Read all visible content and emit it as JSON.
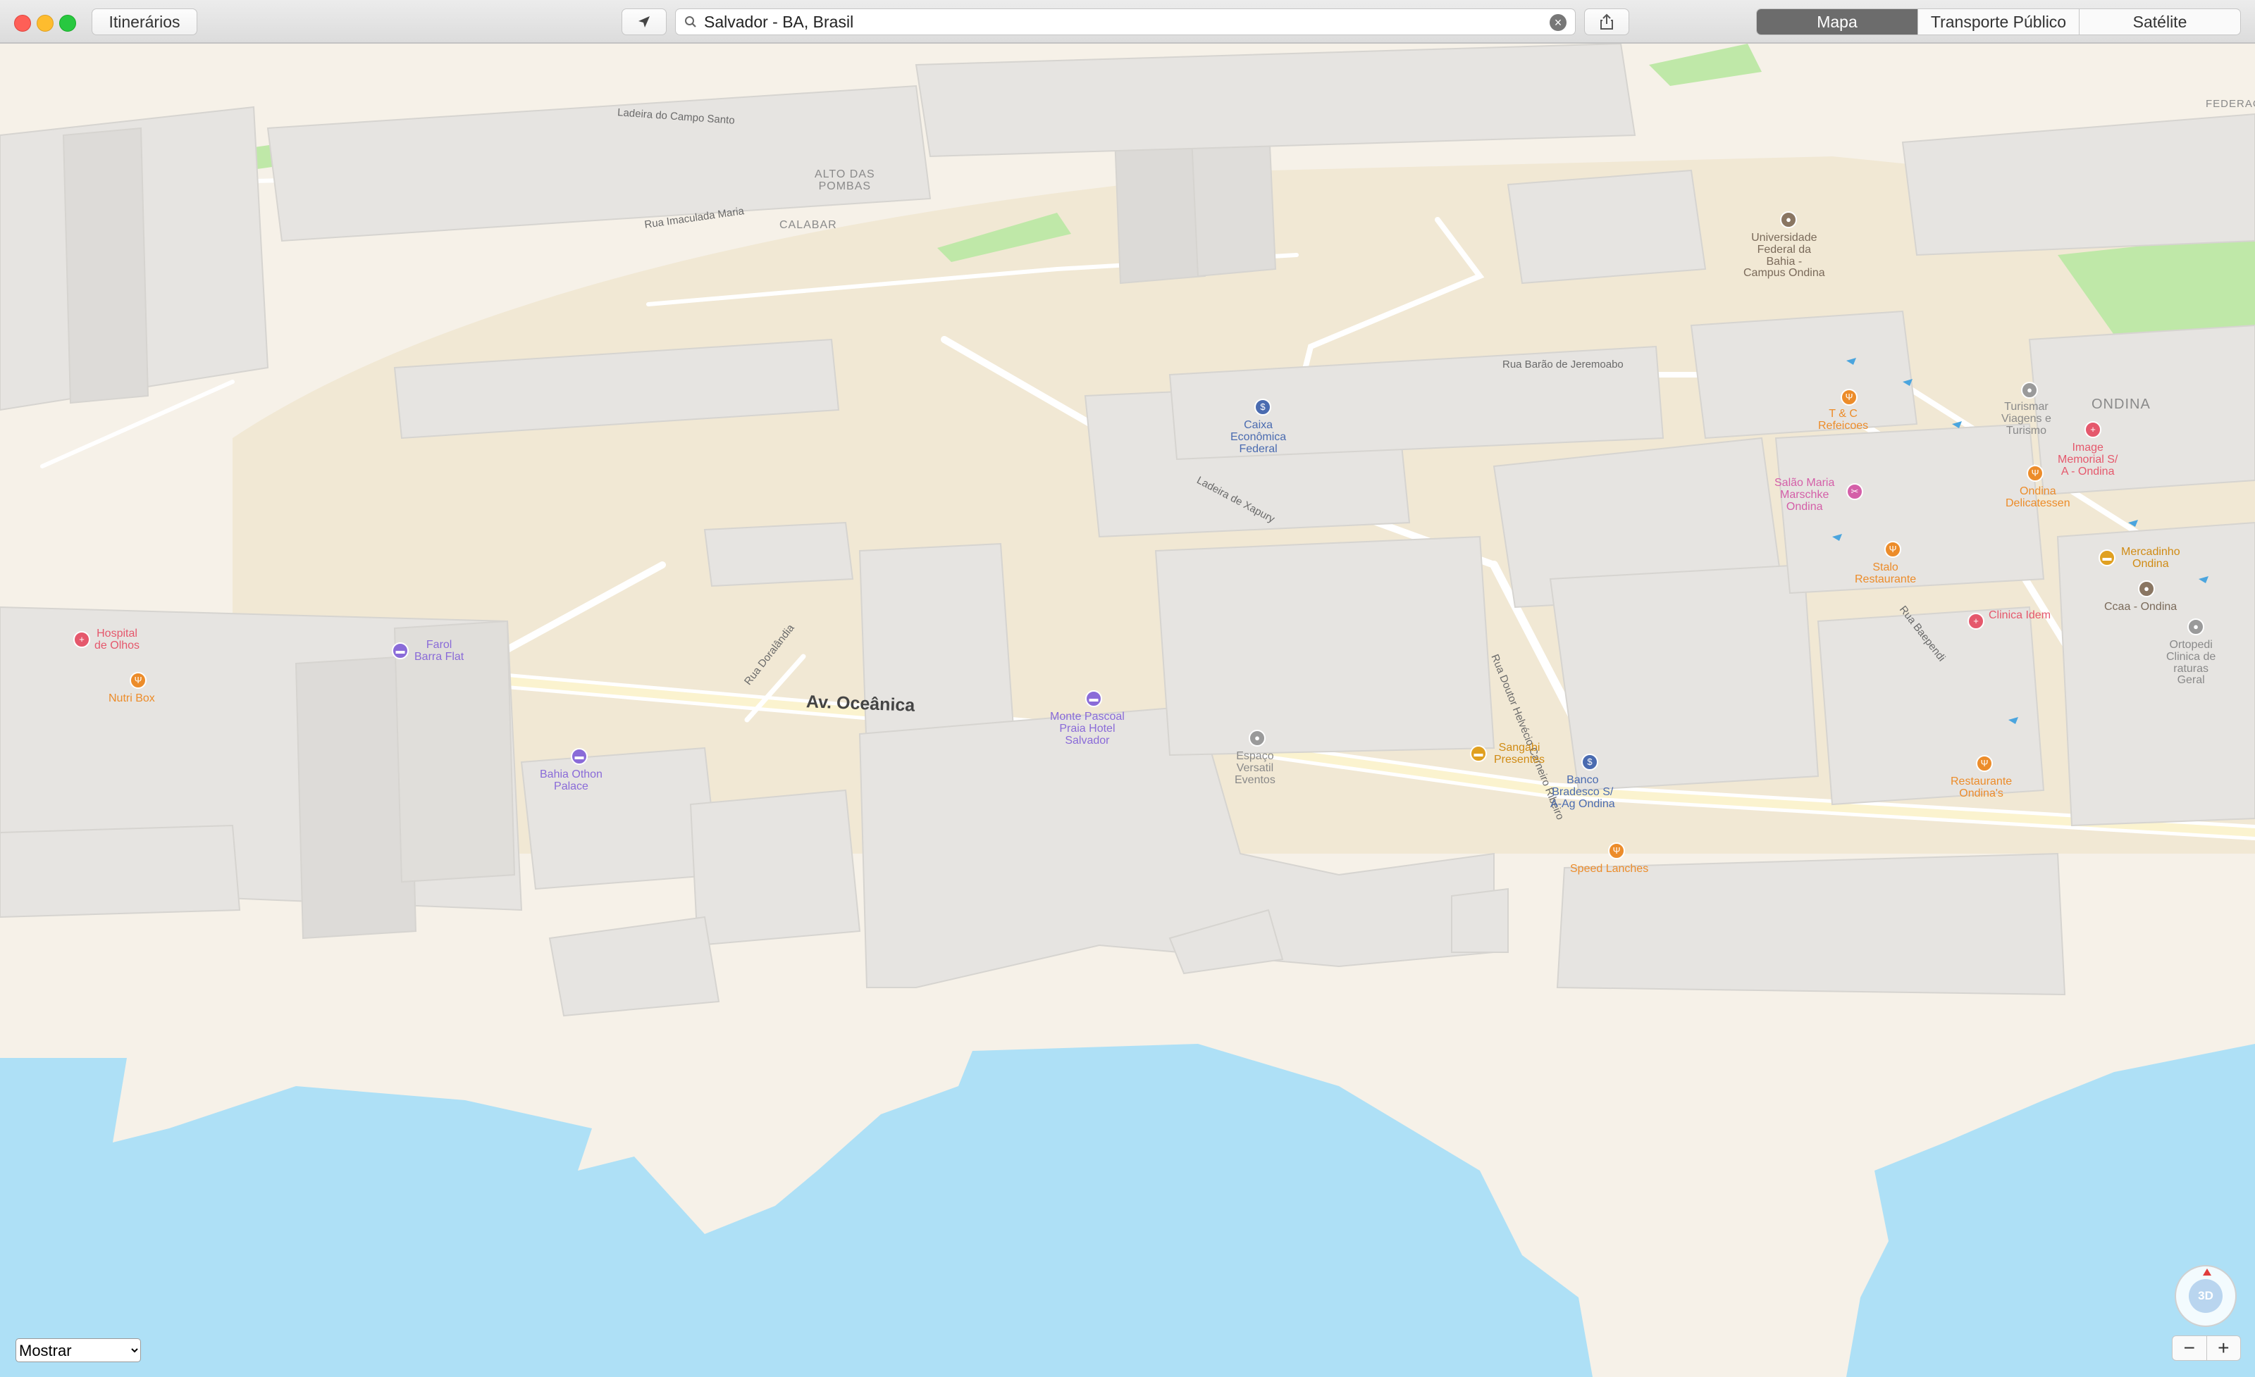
{
  "toolbar": {
    "directions_label": "Itinerários",
    "search_value": "Salvador - BA, Brasil",
    "map_modes": [
      {
        "label": "Mapa",
        "active": true
      },
      {
        "label": "Transporte Público",
        "active": false
      },
      {
        "label": "Satélite",
        "active": false
      }
    ]
  },
  "map": {
    "streets": {
      "campo_santo": "Ladeira do Campo Santo",
      "imaculada_maria": "Rua Imaculada Maria",
      "barao_jeremoabo": "Rua Barão de Jeremoabo",
      "xapuri": "Ladeira de Xapury",
      "doralandia": "Rua Doralândia",
      "helvecio": "Rua Doutor Helvécio Carneiro Ribeiro",
      "baependi": "Rua Baependi",
      "oceanica": "Av. Oceânica"
    },
    "areas": {
      "alto_das_pombas": "ALTO DAS\nPOMBAS",
      "calabar": "CALABAR",
      "ondina": "ONDINA",
      "federacao": "FEDERAC"
    },
    "pois": [
      {
        "id": "hospital-olhos",
        "label": "Hospital\nde Olhos",
        "color": "red",
        "glyph": "+"
      },
      {
        "id": "nutri-box",
        "label": "Nutri Box",
        "color": "orange",
        "glyph": "Ψ"
      },
      {
        "id": "farol-barra-flat",
        "label": "Farol\nBarra Flat",
        "color": "purple",
        "glyph": "▬"
      },
      {
        "id": "bahia-othon-palace",
        "label": "Bahia Othon\nPalace",
        "color": "purple",
        "glyph": "▬"
      },
      {
        "id": "monte-pascoal",
        "label": "Monte Pascoal\nPraia Hotel\nSalvador",
        "color": "purple",
        "glyph": "▬"
      },
      {
        "id": "espaco-versatil",
        "label": "Espaço\nVersatil\nEventos",
        "color": "gray",
        "glyph": "●"
      },
      {
        "id": "caixa",
        "label": "Caixa\nEconômica\nFederal",
        "color": "blue",
        "glyph": "$"
      },
      {
        "id": "sangabi",
        "label": "Sangabi\nPresentes",
        "color": "gold",
        "glyph": "▬"
      },
      {
        "id": "bradesco",
        "label": "Banco\nBradesco S/\nA-Ag Ondina",
        "color": "blue",
        "glyph": "$"
      },
      {
        "id": "speed-lanches",
        "label": "Speed Lanches",
        "color": "orange",
        "glyph": "Ψ"
      },
      {
        "id": "universidade",
        "label": "Universidade\nFederal da\nBahia -\nCampus Ondina",
        "color": "brown",
        "glyph": "●"
      },
      {
        "id": "tc-refeicoes",
        "label": "T & C\nRefeicoes",
        "color": "orange",
        "glyph": "Ψ"
      },
      {
        "id": "turismar",
        "label": "Turismar\nViagens e\nTurismo",
        "color": "gray",
        "glyph": "●"
      },
      {
        "id": "image-memorial",
        "label": "Image\nMemorial S/\nA - Ondina",
        "color": "red",
        "glyph": "+"
      },
      {
        "id": "salao-maria",
        "label": "Salão Maria\nMarschke\nOndina",
        "color": "pink",
        "glyph": "✂"
      },
      {
        "id": "ondina-delicatessen",
        "label": "Ondina\nDelicatessen",
        "color": "orange",
        "glyph": "Ψ"
      },
      {
        "id": "mercadinho",
        "label": "Mercadinho\nOndina",
        "color": "gold",
        "glyph": "▬"
      },
      {
        "id": "stalo",
        "label": "Stalo\nRestaurante",
        "color": "orange",
        "glyph": "Ψ"
      },
      {
        "id": "ccaa",
        "label": "Ccaa - Ondina",
        "color": "brown",
        "glyph": "●"
      },
      {
        "id": "clinica-idem",
        "label": "Clinica Idem",
        "color": "red",
        "glyph": "+"
      },
      {
        "id": "ortopedia",
        "label": "Ortopedi\nClinica de\nraturas\nGeral",
        "color": "gray",
        "glyph": "●"
      },
      {
        "id": "restaurante-ondina",
        "label": "Restaurante\nOndina's",
        "color": "orange",
        "glyph": "Ψ"
      }
    ]
  },
  "bottom": {
    "show_select": "Mostrar",
    "compass_label": "3D",
    "zoom_out": "−",
    "zoom_in": "+"
  },
  "icons": {
    "location": "location-arrow-icon",
    "search": "search-icon",
    "clear": "clear-icon",
    "share": "share-icon"
  },
  "colors": {
    "water": "#aee0f6",
    "land": "#f6f1e8",
    "urban": "#f1e8d4",
    "park": "#bfe8a8",
    "building": "#e6e4e1",
    "segment_active": "#6c6c6c"
  }
}
